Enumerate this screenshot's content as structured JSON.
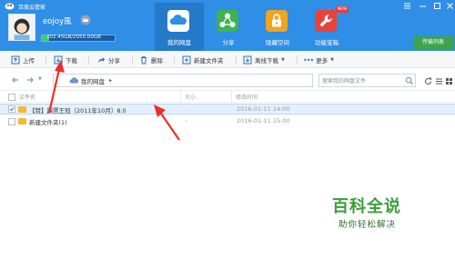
{
  "window": {
    "title": "百度云管家"
  },
  "user": {
    "name": "eojoy風",
    "quota_text": "202.45GB/2055.00GB",
    "quota_fraction": 0.1
  },
  "nav": {
    "tabs": [
      {
        "label": "我的网盘",
        "icon": "cloud-icon"
      },
      {
        "label": "分享",
        "icon": "share-icon"
      },
      {
        "label": "隐藏空间",
        "icon": "lock-icon"
      },
      {
        "label": "功能宝箱",
        "icon": "wrench-icon"
      }
    ],
    "new_badge": "NEW",
    "promo_label": "传输列表"
  },
  "toolbar": {
    "upload": "上传",
    "download": "下载",
    "share": "分享",
    "delete": "删除",
    "new_folder": "新建文件夹",
    "offline_download": "离线下载",
    "more": "更多"
  },
  "address": {
    "path": "我的网盘",
    "search_placeholder": "搜索我的网盘文件"
  },
  "table": {
    "headers": {
      "name": "文件名",
      "size": "大小",
      "modified": "修改时间"
    },
    "rows": [
      {
        "name": "【赞】霹雳王冠（2011年10月）8.0",
        "size": "-",
        "modified": "2016-01-11 14:00",
        "selected": true
      },
      {
        "name": "新建文件夹(1)",
        "size": "-",
        "modified": "2016-01-11 15:00",
        "selected": false
      }
    ]
  },
  "watermark": {
    "title": "百科全说",
    "subtitle": "助你轻松解决"
  },
  "colors": {
    "header": "#2f8ee6",
    "accent_red": "#e8302a",
    "folder": "#f4b740",
    "watermark": "#3a9e3a"
  }
}
